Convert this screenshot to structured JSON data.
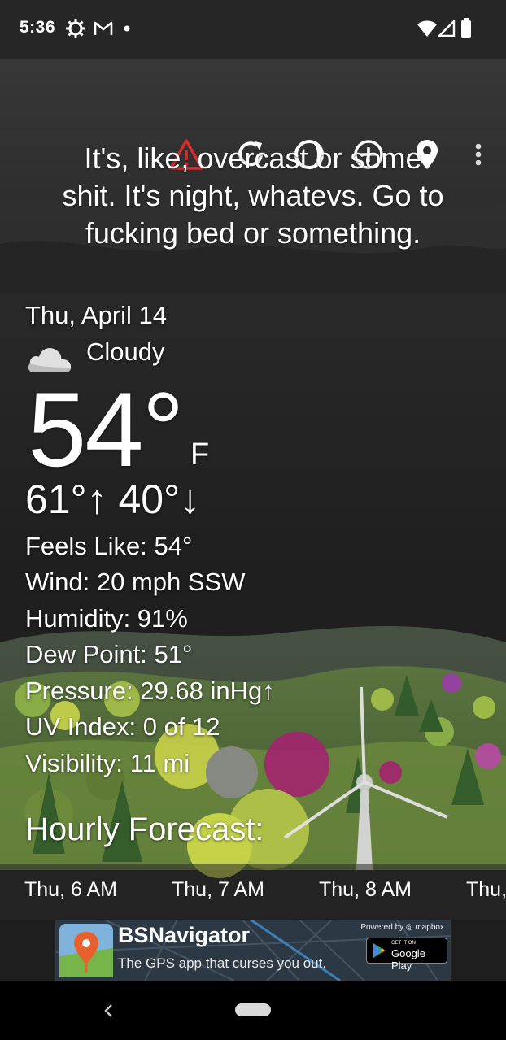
{
  "status_bar": {
    "time": "5:36",
    "icons": [
      "settings-gear-icon",
      "gmail-icon",
      "notification-dot-icon",
      "wifi-icon",
      "cell-signal-icon",
      "battery-icon"
    ]
  },
  "toolbar": {
    "buttons": [
      "alert-warning-icon",
      "refresh-icon",
      "theme-icon",
      "add-location-icon",
      "location-pin-icon",
      "overflow-menu-icon"
    ],
    "alert_color": "#d32f2f"
  },
  "snark": {
    "line1": "It's, like, overcast or some",
    "line2": "shit. It's night, whatevs. Go to",
    "line3": "fucking bed or something."
  },
  "current": {
    "date": "Thu, April 14",
    "condition": "Cloudy",
    "condition_icon": "cloud-icon",
    "temperature": "54°",
    "unit": "F",
    "hi_lo": "61°↑ 40°↓",
    "feels_like": "Feels Like:  54°",
    "wind": "Wind:  20 mph SSW",
    "humidity": "Humidity:  91%",
    "dew_point": "Dew Point:  51°",
    "pressure": "Pressure:  29.68 inHg↑",
    "uv_index": "UV Index:  0 of 12",
    "visibility": "Visibility:  11 mi"
  },
  "hourly": {
    "title": "Hourly Forecast:",
    "hours": [
      "Thu, 6 AM",
      "Thu, 7 AM",
      "Thu, 8 AM",
      "Thu,"
    ]
  },
  "ad": {
    "powered_by": "Powered by ◎ mapbox",
    "title": "BSNavigator",
    "subtitle": "The GPS app that curses you out.",
    "store_small": "GET IT ON",
    "store_big": "Google Play"
  },
  "nav": {
    "back": "‹"
  }
}
